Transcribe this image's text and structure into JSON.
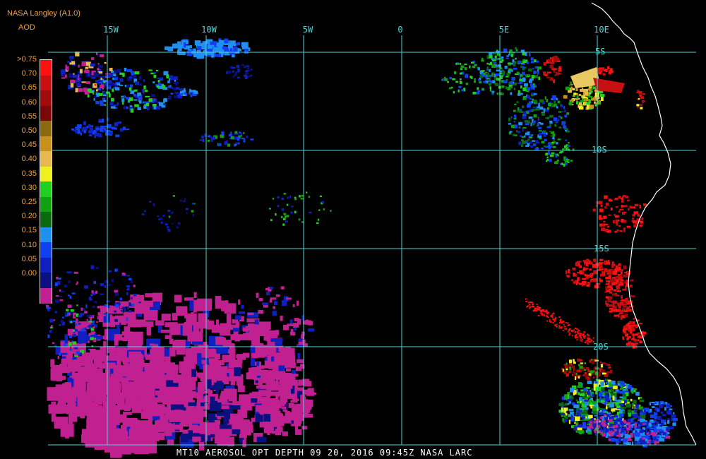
{
  "header": {
    "source": "NASA Langley (A1.0)",
    "variable": "AOD"
  },
  "footer": {
    "caption": "MT10  AEROSOL OPT DEPTH   09 20, 2016 09:45Z   NASA LARC"
  },
  "grid": {
    "color": "#4fd6d6",
    "lon_labels": [
      "15W",
      "10W",
      "5W",
      "0",
      "5E",
      "10E"
    ],
    "lat_labels": [
      "5S",
      "10S",
      "15S",
      "20S"
    ]
  },
  "colorbar": {
    "labels": [
      ">0.75",
      "0.70",
      "0.65",
      "0.60",
      "0.55",
      "0.50",
      "0.45",
      "0.40",
      "0.35",
      "0.30",
      "0.25",
      "0.20",
      "0.15",
      "0.10",
      "0.05",
      "0.00"
    ],
    "colors": [
      "#ff1010",
      "#c81010",
      "#a00c0c",
      "#7a0808",
      "#8a6a10",
      "#c8901c",
      "#e8b850",
      "#f0f020",
      "#20d020",
      "#10a010",
      "#0a6a10",
      "#2090f0",
      "#1040f0",
      "#1020c0",
      "#0a1080",
      "#c02090"
    ]
  },
  "chart_data": {
    "type": "heatmap",
    "title": "MT10  AEROSOL OPT DEPTH   09 20, 2016 09:45Z   NASA LARC",
    "legend_title": "AOD",
    "color_scale": [
      0.0,
      0.05,
      0.1,
      0.15,
      0.2,
      0.25,
      0.3,
      0.35,
      0.4,
      0.45,
      0.5,
      0.55,
      0.6,
      0.65,
      0.7,
      0.75
    ],
    "lon_range": [
      "18W",
      "13E"
    ],
    "lat_range": [
      "3S",
      "25S"
    ],
    "regions": [
      {
        "area": "southwest ocean",
        "aod": "0.00-0.05"
      },
      {
        "area": "northwest ocean",
        "aod": "0.10-0.20"
      },
      {
        "area": "near Gabon coast 5E-10E 5S-10S",
        "aod": "0.20-0.75"
      },
      {
        "area": "Angola coast 10E-13E 12S-20S",
        "aod": ">0.75"
      },
      {
        "area": "southeast corner 8E-12E 21S-25S",
        "aod": "0.10-0.40"
      }
    ]
  }
}
